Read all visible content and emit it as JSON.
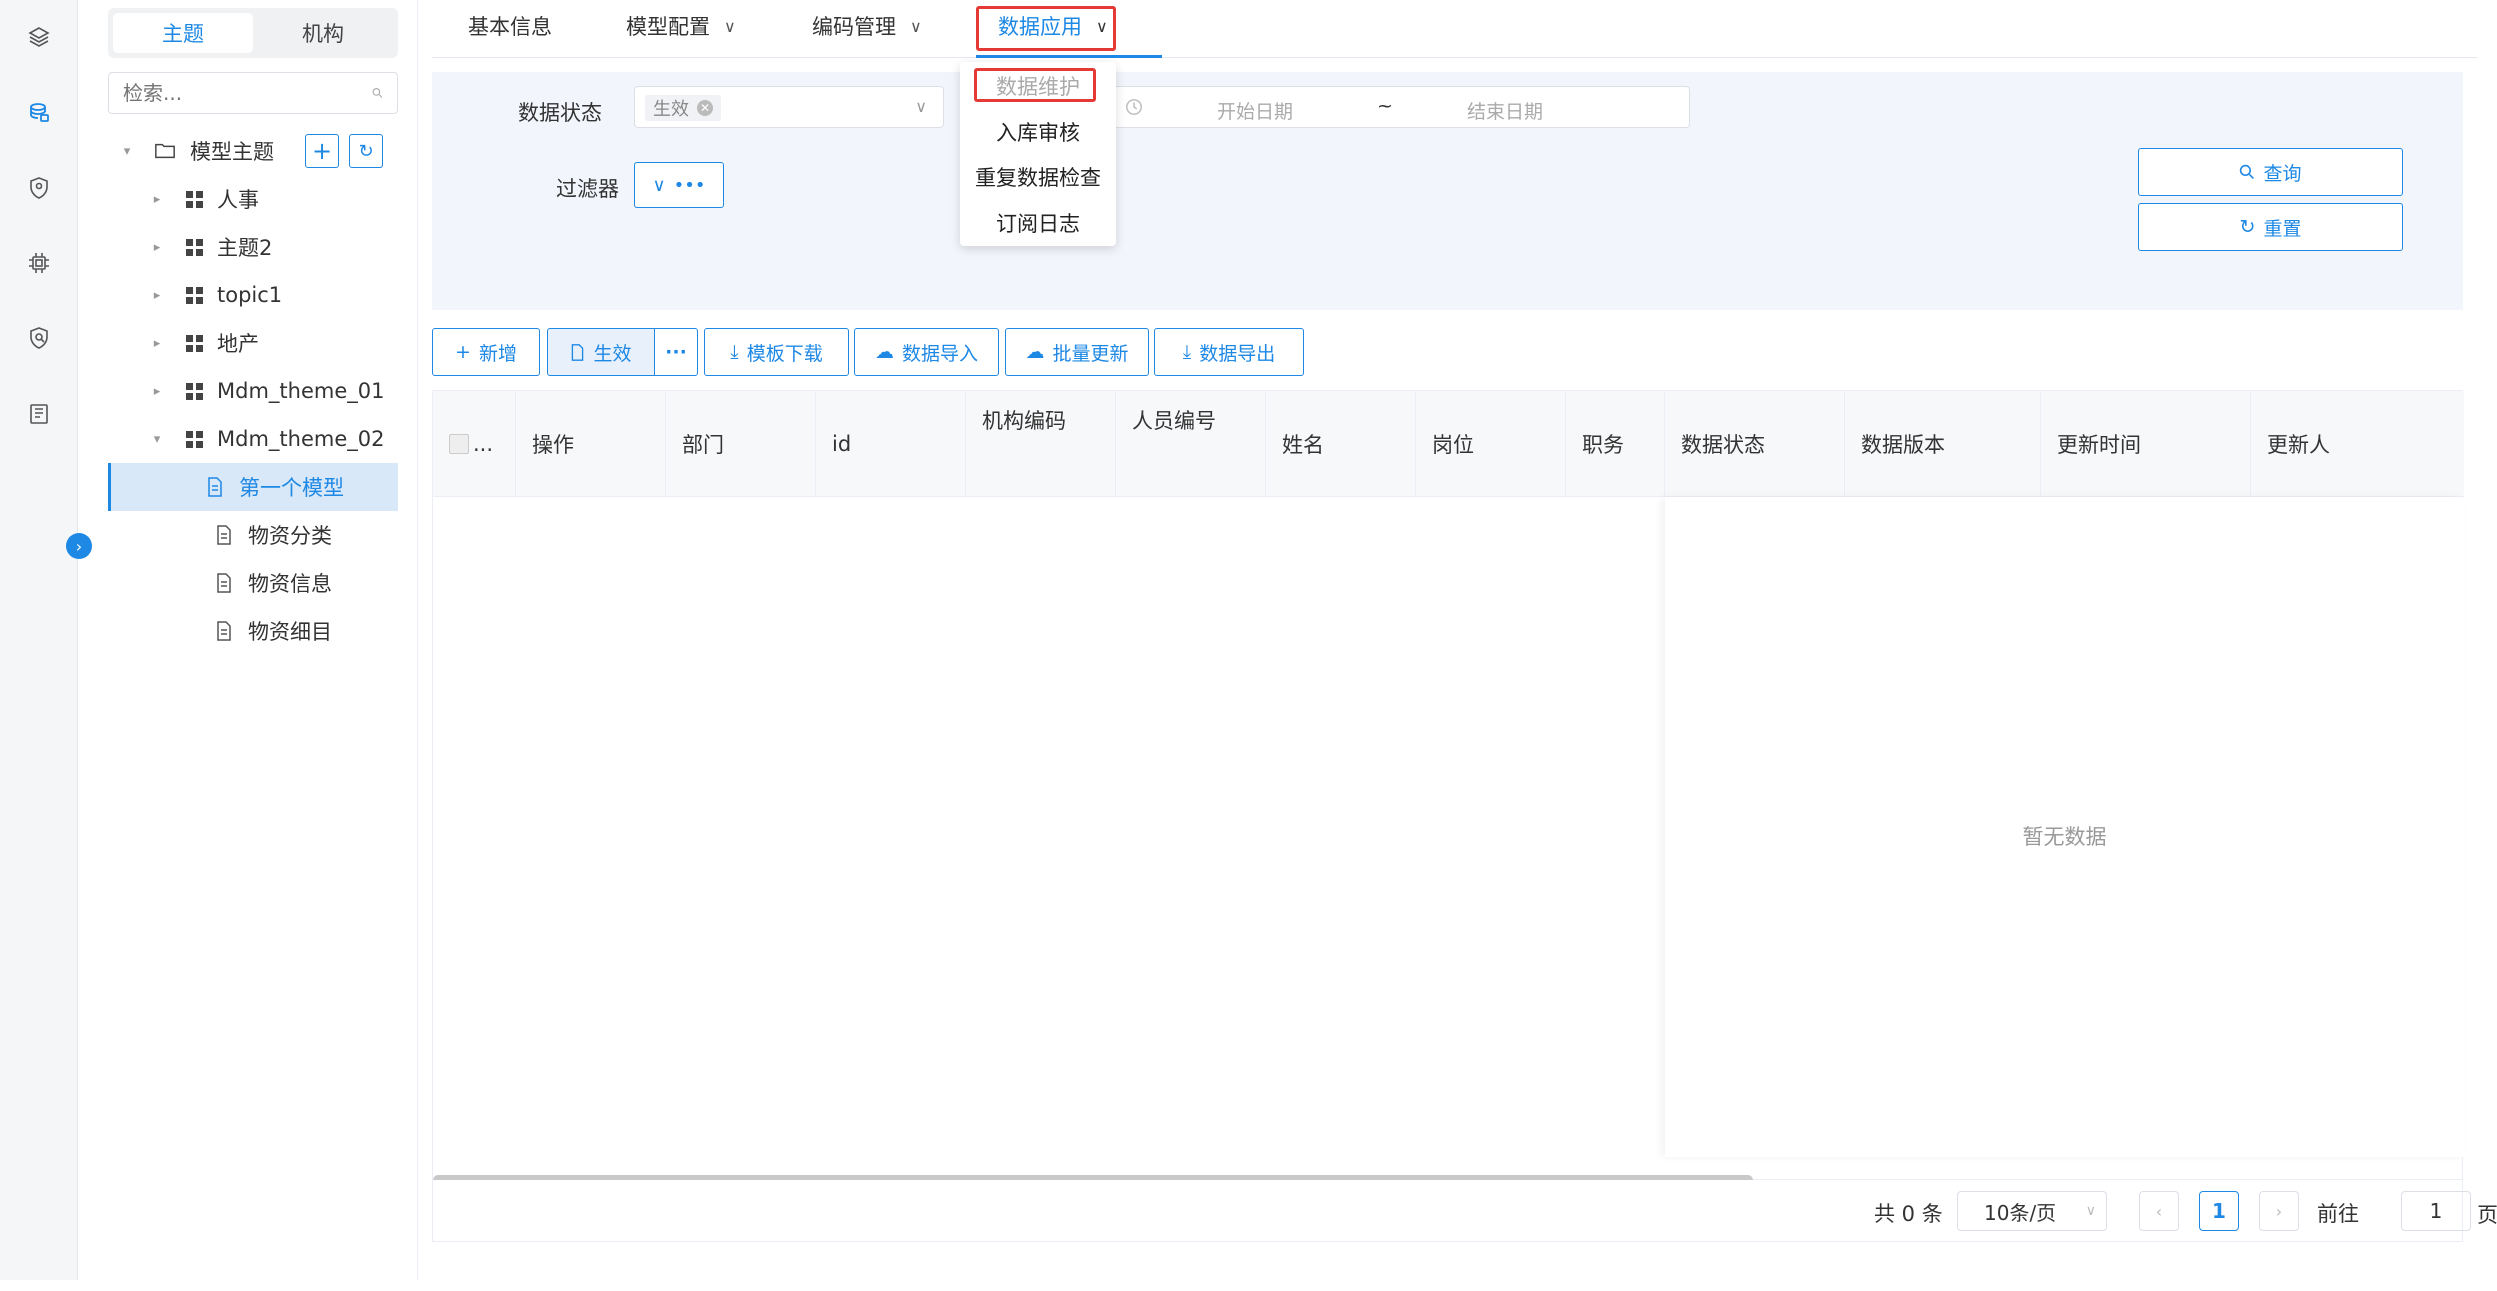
{
  "sidebar": {
    "icons": [
      "layers-icon",
      "database-icon",
      "shield-location-icon",
      "chip-icon",
      "security-icon",
      "document-list-icon"
    ]
  },
  "tree": {
    "seg_theme": "主题",
    "seg_org": "机构",
    "search_placeholder": "检索...",
    "root_label": "模型主题",
    "items": [
      {
        "label": "人事"
      },
      {
        "label": "主题2"
      },
      {
        "label": "topic1"
      },
      {
        "label": "地产"
      },
      {
        "label": "Mdm_theme_01"
      },
      {
        "label": "Mdm_theme_02"
      }
    ],
    "children": [
      {
        "label": "第一个模型"
      },
      {
        "label": "物资分类"
      },
      {
        "label": "物资信息"
      },
      {
        "label": "物资细目"
      }
    ]
  },
  "tabs": {
    "basic": "基本信息",
    "model_config": "模型配置",
    "code_mgmt": "编码管理",
    "data_app": "数据应用"
  },
  "dropdown": {
    "items": [
      "数据维护",
      "入库审核",
      "重复数据检查",
      "订阅日志"
    ]
  },
  "filter": {
    "status_label": "数据状态",
    "status_tag": "生效",
    "start_placeholder": "开始日期",
    "range_sep": "~",
    "end_placeholder": "结束日期",
    "filter_label": "过滤器",
    "query": "查询",
    "reset": "重置"
  },
  "toolbar": {
    "add": "新增",
    "effective": "生效",
    "more": "···",
    "template": "模板下载",
    "import": "数据导入",
    "batch": "批量更新",
    "export": "数据导出"
  },
  "table": {
    "select_ellipsis": "...",
    "columns": [
      "操作",
      "部门",
      "id",
      "机构编码",
      "人员编号",
      "姓名",
      "岗位",
      "职务",
      "数据状态",
      "数据版本",
      "更新时间",
      "更新人"
    ],
    "empty": "暂无数据"
  },
  "pager": {
    "total": "共 0 条",
    "page_size": "10条/页",
    "current": "1",
    "goto_prefix": "前往",
    "goto_value": "1",
    "goto_suffix": "页"
  },
  "colors": {
    "accent": "#1e88e5",
    "highlight": "#e53935"
  }
}
